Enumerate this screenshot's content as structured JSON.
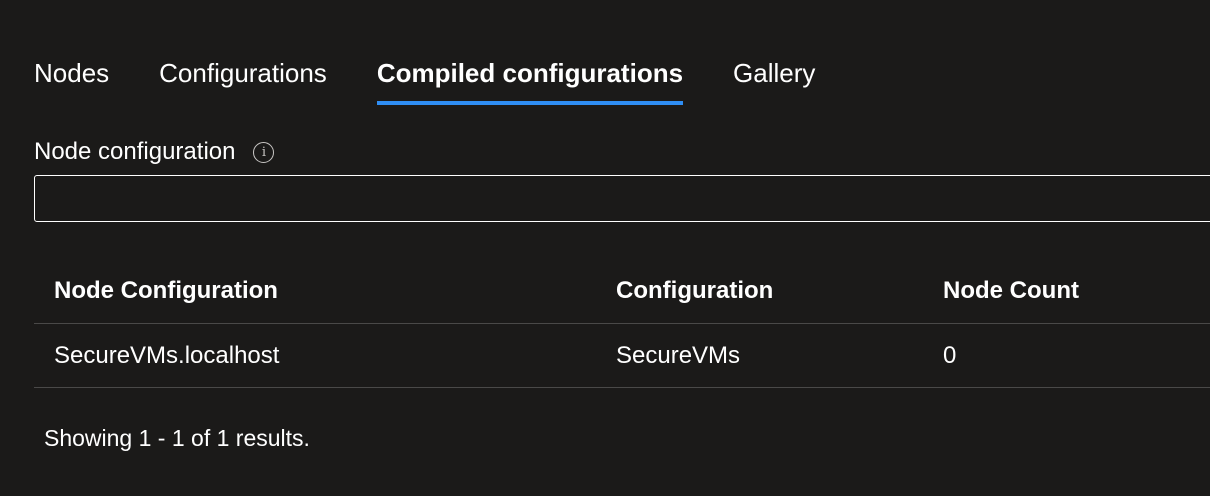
{
  "tabs": [
    {
      "label": "Nodes",
      "active": false
    },
    {
      "label": "Configurations",
      "active": false
    },
    {
      "label": "Compiled configurations",
      "active": true
    },
    {
      "label": "Gallery",
      "active": false
    }
  ],
  "filter": {
    "label": "Node configuration",
    "info_icon": "info-icon",
    "value": "",
    "placeholder": ""
  },
  "table": {
    "headers": [
      "Node Configuration",
      "Configuration",
      "Node Count"
    ],
    "rows": [
      [
        "SecureVMs.localhost",
        "SecureVMs",
        "0"
      ]
    ]
  },
  "results_text": "Showing 1 - 1 of 1 results.",
  "colors": {
    "background": "#1b1a19",
    "accent": "#2f8ef4",
    "divider": "#4a4948"
  }
}
